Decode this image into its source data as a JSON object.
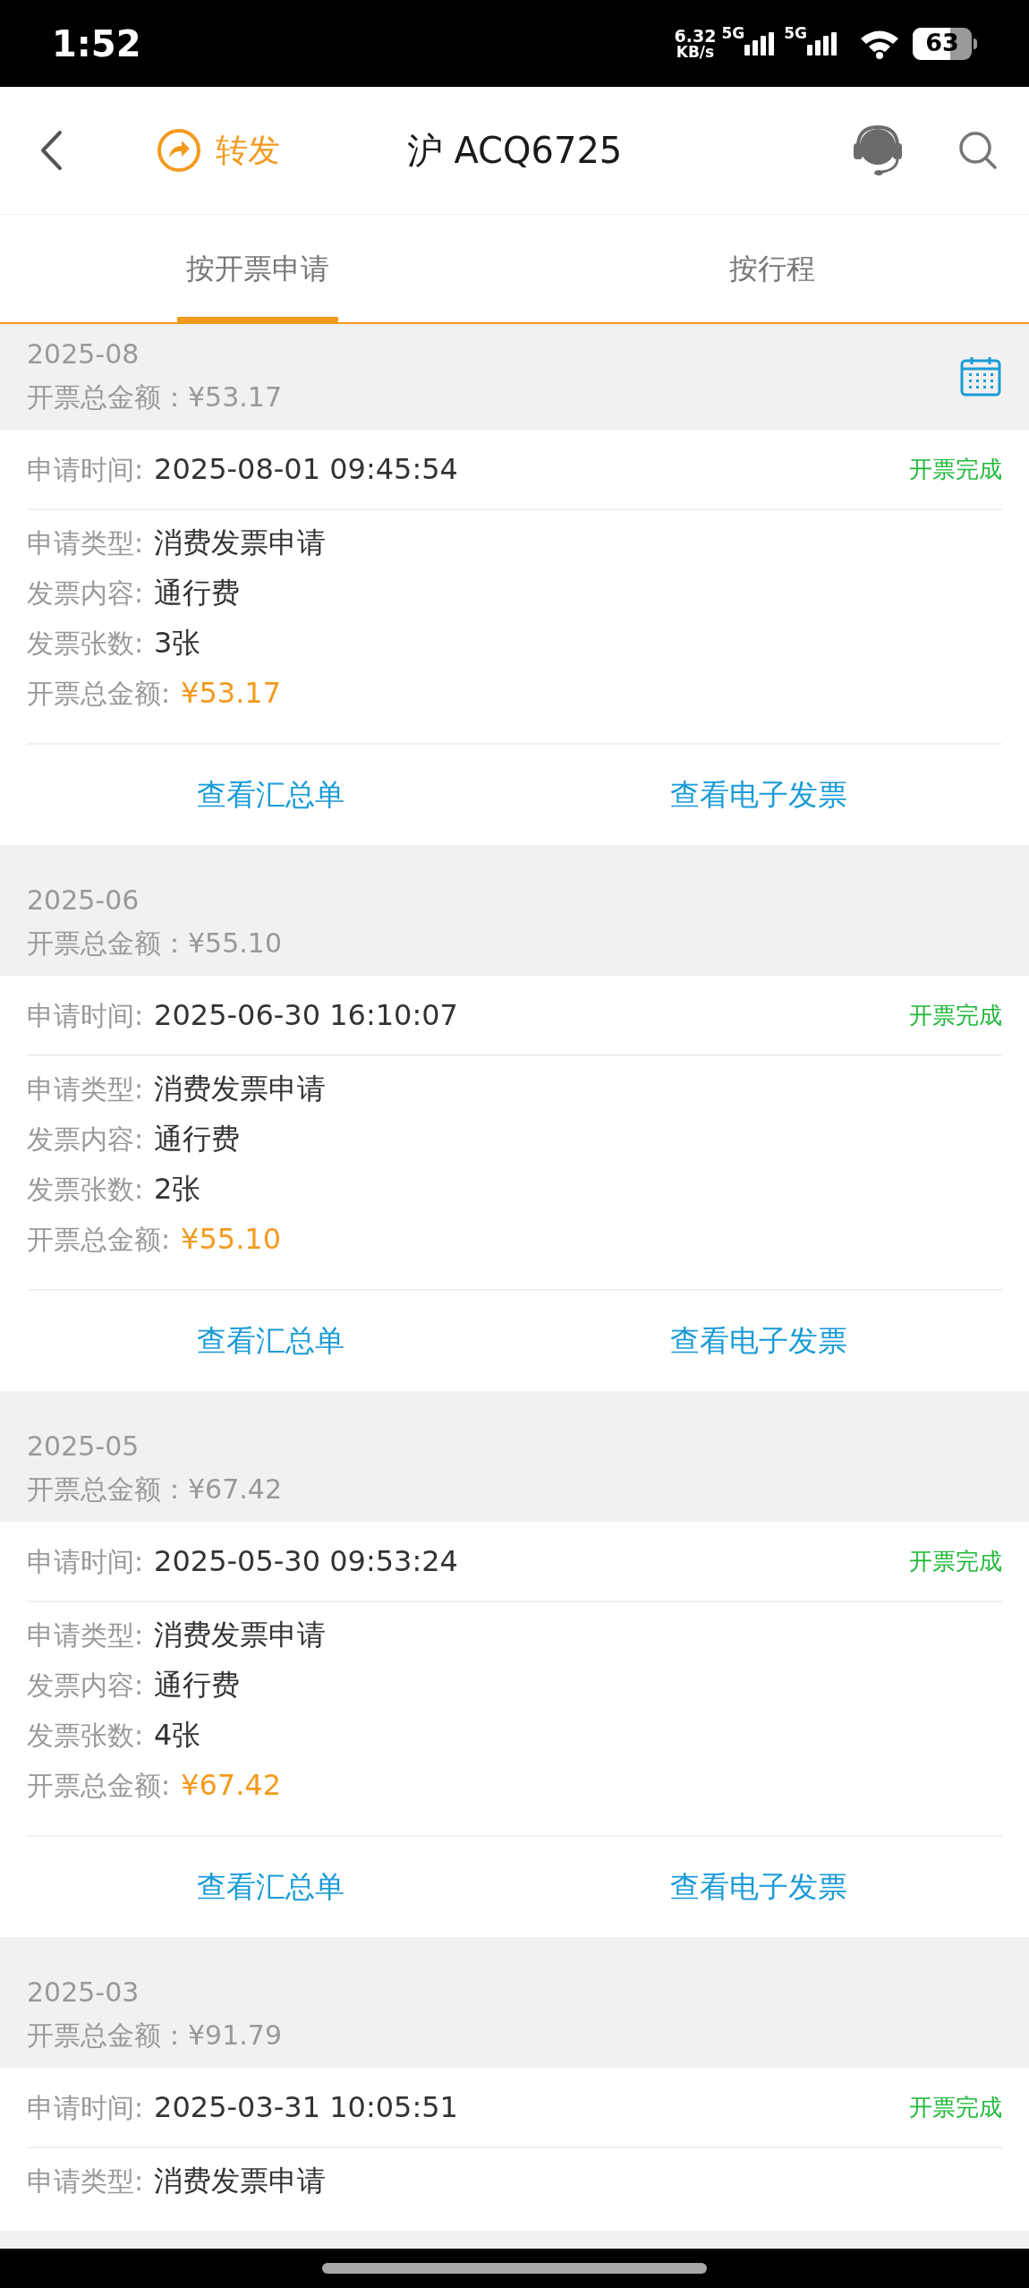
{
  "status_bar": {
    "time": "1:52",
    "net_speed": "6.32",
    "net_unit": "KB/s",
    "signals": [
      "5G",
      "5G"
    ],
    "battery": "63"
  },
  "header": {
    "forward_label": "转发",
    "title": "沪 ACQ6725"
  },
  "tabs": [
    {
      "label": "按开票申请",
      "selected": true
    },
    {
      "label": "按行程",
      "selected": false
    }
  ],
  "sections": [
    {
      "month": "2025-08",
      "total": "开票总金额：¥53.17",
      "calendar": true,
      "card": {
        "time_label": "申请时间:",
        "time": "2025-08-01 09:45:54",
        "status": "开票完成",
        "details": [
          {
            "label": "申请类型:",
            "value": "消费发票申请",
            "kind": "text"
          },
          {
            "label": "发票内容:",
            "value": "通行费",
            "kind": "text"
          },
          {
            "label": "发票张数:",
            "value": "3张",
            "kind": "text"
          },
          {
            "label": "开票总金额:",
            "value": "¥53.17",
            "kind": "amount"
          }
        ],
        "actions": [
          "查看汇总单",
          "查看电子发票"
        ]
      }
    },
    {
      "month": "2025-06",
      "total": "开票总金额：¥55.10",
      "calendar": false,
      "card": {
        "time_label": "申请时间:",
        "time": "2025-06-30 16:10:07",
        "status": "开票完成",
        "details": [
          {
            "label": "申请类型:",
            "value": "消费发票申请",
            "kind": "text"
          },
          {
            "label": "发票内容:",
            "value": "通行费",
            "kind": "text"
          },
          {
            "label": "发票张数:",
            "value": "2张",
            "kind": "text"
          },
          {
            "label": "开票总金额:",
            "value": "¥55.10",
            "kind": "amount"
          }
        ],
        "actions": [
          "查看汇总单",
          "查看电子发票"
        ]
      }
    },
    {
      "month": "2025-05",
      "total": "开票总金额：¥67.42",
      "calendar": false,
      "card": {
        "time_label": "申请时间:",
        "time": "2025-05-30 09:53:24",
        "status": "开票完成",
        "details": [
          {
            "label": "申请类型:",
            "value": "消费发票申请",
            "kind": "text"
          },
          {
            "label": "发票内容:",
            "value": "通行费",
            "kind": "text"
          },
          {
            "label": "发票张数:",
            "value": "4张",
            "kind": "text"
          },
          {
            "label": "开票总金额:",
            "value": "¥67.42",
            "kind": "amount"
          }
        ],
        "actions": [
          "查看汇总单",
          "查看电子发票"
        ]
      }
    },
    {
      "month": "2025-03",
      "total": "开票总金额：¥91.79",
      "calendar": false,
      "card": {
        "time_label": "申请时间:",
        "time": "2025-03-31 10:05:51",
        "status": "开票完成",
        "details": [
          {
            "label": "申请类型:",
            "value": "消费发票申请",
            "kind": "text"
          }
        ]
      }
    }
  ]
}
